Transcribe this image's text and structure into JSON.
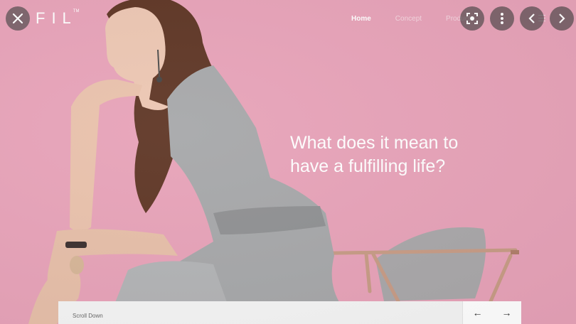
{
  "brand": {
    "logo": "FIL",
    "trademark": "TM"
  },
  "nav": {
    "items": [
      "Home",
      "Concept",
      "Product"
    ],
    "active": "Home"
  },
  "hero": {
    "headline_line1": "What does it mean to",
    "headline_line2": "have a fulfilling life?"
  },
  "footer": {
    "scroll_label": "Scroll Down",
    "prev_arrow": "←",
    "next_arrow": "→"
  },
  "viewer": {
    "buttons": [
      "close-icon",
      "lens-icon",
      "more-vert-icon",
      "chevron-left-icon",
      "chevron-right-icon"
    ]
  },
  "colors": {
    "background": "#e7a2b8",
    "dress": "#a7a8aa",
    "hair": "#6b3d2a",
    "skin": "#e8c2ad"
  }
}
